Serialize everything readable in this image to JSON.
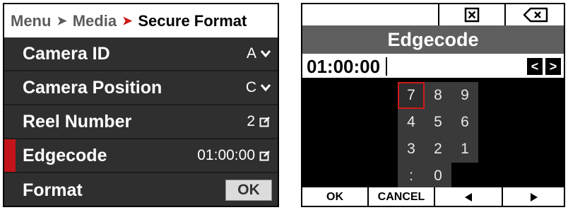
{
  "left_panel": {
    "breadcrumb": {
      "item1": "Menu",
      "item2": "Media",
      "current": "Secure Format"
    },
    "rows": [
      {
        "label": "Camera ID",
        "value": "A",
        "icon": "chevron-down-icon"
      },
      {
        "label": "Camera Position",
        "value": "C",
        "icon": "chevron-down-icon"
      },
      {
        "label": "Reel Number",
        "value": "2",
        "icon": "edit-icon"
      },
      {
        "label": "Edgecode",
        "value": "01:00:00",
        "icon": "edit-icon",
        "selected": true
      },
      {
        "label": "Format",
        "button": "OK"
      }
    ],
    "colors": {
      "accent": "#c4141b",
      "row_bg": "#2f2f2f"
    }
  },
  "right_panel": {
    "topbar": {
      "close_icon": "close-box-icon",
      "backspace_icon": "backspace-icon"
    },
    "title": "Edgecode",
    "input": {
      "value": "01:00:00",
      "left_label": "<",
      "right_label": ">"
    },
    "keypad": {
      "rows": [
        [
          "7",
          "8",
          "9"
        ],
        [
          "4",
          "5",
          "6"
        ],
        [
          "3",
          "2",
          "1"
        ],
        [
          ":",
          "0"
        ]
      ],
      "selected": "7"
    },
    "bottom": {
      "ok": "OK",
      "cancel": "CANCEL",
      "prev_icon": "triangle-left-icon",
      "next_icon": "triangle-right-icon"
    }
  }
}
